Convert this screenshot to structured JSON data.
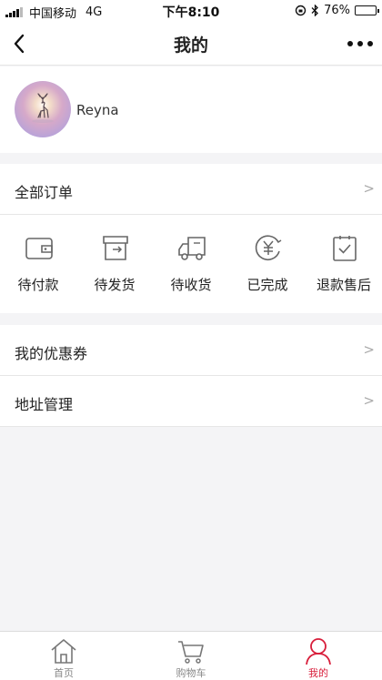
{
  "status_bar": {
    "carrier": "中国移动",
    "network": "4G",
    "time": "下午8:10",
    "battery": "76%",
    "battery_level": 0.76
  },
  "nav": {
    "title": "我的",
    "back_icon": "chevron-left-icon",
    "more_icon": "more-dots-icon"
  },
  "profile": {
    "username": "Reyna"
  },
  "all_orders": {
    "label": "全部订单",
    "arrow": ">"
  },
  "order_types": [
    {
      "label": "待付款",
      "icon": "wallet-icon"
    },
    {
      "label": "待发货",
      "icon": "box-icon"
    },
    {
      "label": "待收货",
      "icon": "truck-icon"
    },
    {
      "label": "已完成",
      "icon": "yuan-icon"
    },
    {
      "label": "退款售后",
      "icon": "clipboard-check-icon"
    }
  ],
  "menu": [
    {
      "label": "我的优惠券",
      "arrow": ">"
    },
    {
      "label": "地址管理",
      "arrow": ">"
    }
  ],
  "tabs": [
    {
      "label": "首页",
      "icon": "home-icon"
    },
    {
      "label": "购物车",
      "icon": "cart-icon"
    },
    {
      "label": "我的",
      "icon": "user-icon",
      "active": true
    }
  ],
  "colors": {
    "accent": "#d81e3b",
    "background": "#f4f4f6"
  }
}
